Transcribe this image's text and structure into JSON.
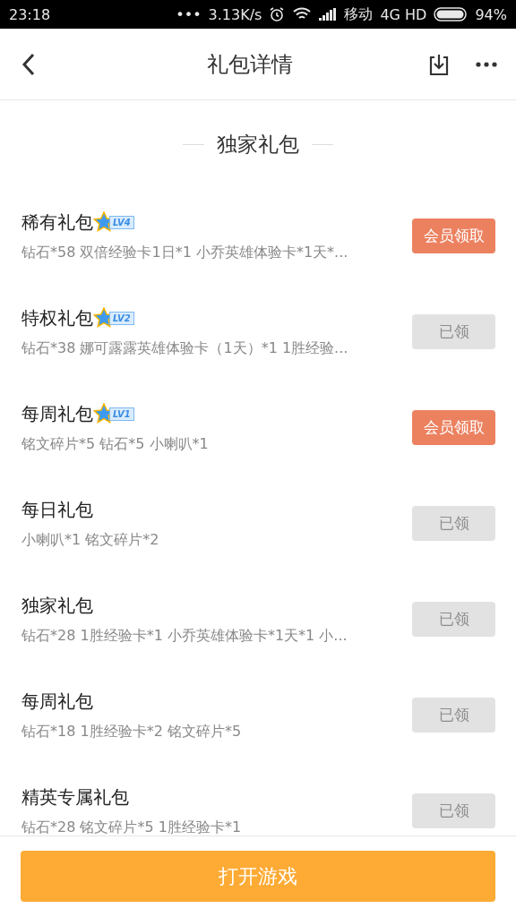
{
  "status_bar": {
    "time": "23:18",
    "more": "•••",
    "speed": "3.13K/s",
    "carrier": "移动",
    "network": "4G HD",
    "battery": "94%"
  },
  "header": {
    "title": "礼包详情"
  },
  "section": {
    "title": "独家礼包"
  },
  "gifts": [
    {
      "name": "稀有礼包",
      "badge": "LV4",
      "contents": "钻石*58 双倍经验卡1日*1 小乔英雄体验卡*1天*...",
      "button": "会员领取",
      "claimed": false
    },
    {
      "name": "特权礼包",
      "badge": "LV2",
      "contents": "钻石*38 娜可露露英雄体验卡（1天）*1 1胜经验...",
      "button": "已领",
      "claimed": true
    },
    {
      "name": "每周礼包",
      "badge": "LV1",
      "contents": "铭文碎片*5 钻石*5 小喇叭*1",
      "button": "会员领取",
      "claimed": false
    },
    {
      "name": "每日礼包",
      "contents": "小喇叭*1 铭文碎片*2",
      "button": "已领",
      "claimed": true
    },
    {
      "name": "独家礼包",
      "contents": "钻石*28 1胜经验卡*1 小乔英雄体验卡*1天*1 小...",
      "button": "已领",
      "claimed": true
    },
    {
      "name": "每周礼包",
      "contents": "钻石*18 1胜经验卡*2 铭文碎片*5",
      "button": "已领",
      "claimed": true
    },
    {
      "name": "精英专属礼包",
      "contents": "钻石*28 铭文碎片*5 1胜经验卡*1",
      "button": "已领",
      "claimed": true
    }
  ],
  "footer": {
    "button": "打开游戏"
  }
}
